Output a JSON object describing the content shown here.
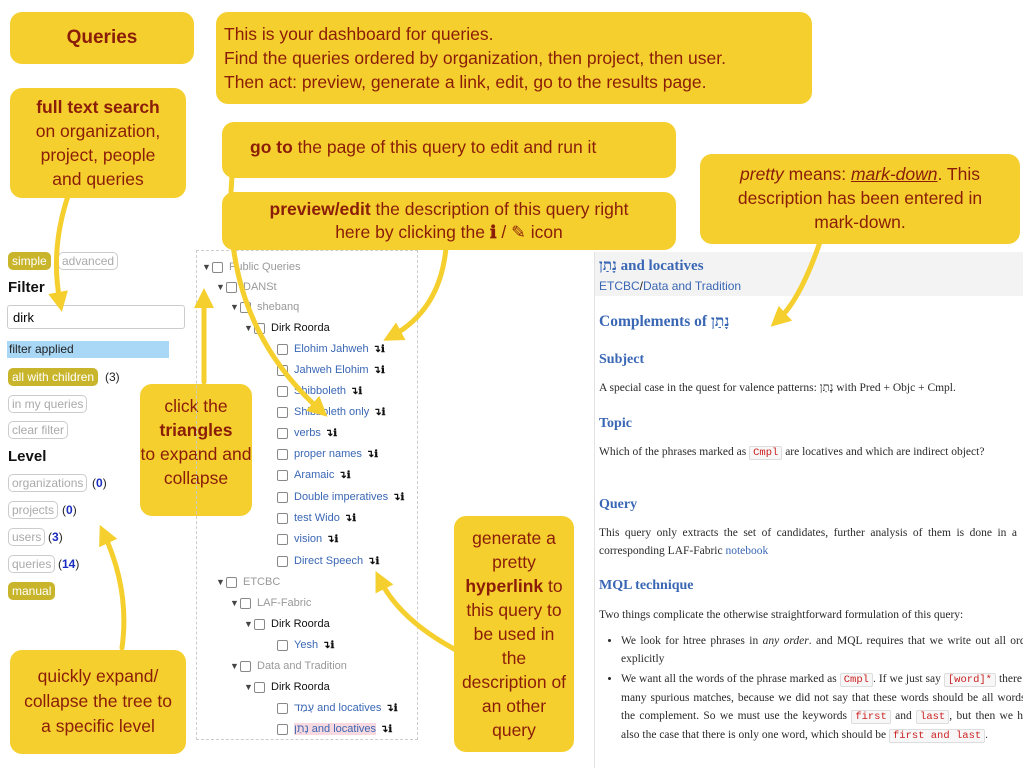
{
  "callouts": {
    "queries": "Queries",
    "dashboard_l1": "This is your dashboard for queries.",
    "dashboard_l2": "Find the queries ordered by organization, then project, then user.",
    "dashboard_l3": "Then act: preview, generate a link, edit, go to the results page.",
    "fts_bold": "full text search",
    "fts_rest_1": "on organization,",
    "fts_rest_2": "project, people",
    "fts_rest_3": "and queries",
    "goto_bold": "go to",
    "goto_rest": "the page of this query to edit and run it",
    "preview_bold": "preview/edit",
    "preview_rest_1": "the description of this query right",
    "preview_rest_2": "here by clicking the",
    "preview_rest_3": "icon",
    "pretty_it": "pretty",
    "pretty_mid": "means:",
    "pretty_md": "mark-down",
    "pretty_end": ". This description has been entered in mark-down.",
    "tri_1": "click the",
    "tri_bold": "triangles",
    "tri_2": "to expand and collapse",
    "gen_1": "generate a pretty",
    "gen_bold": "hyperlink",
    "gen_2": "to this query to be used in the description of an other query",
    "expand": "quickly expand/ collapse the tree to a specific level"
  },
  "filter": {
    "mode_simple": "simple",
    "mode_advanced": "advanced",
    "heading": "Filter",
    "search_value": "dirk",
    "status": "filter applied",
    "all_children": "all with children",
    "all_children_count": "(3)",
    "in_my_queries": "in my queries",
    "clear": "clear filter"
  },
  "level": {
    "heading": "Level",
    "items": [
      {
        "label": "organizations",
        "count": "0"
      },
      {
        "label": "projects",
        "count": "0"
      },
      {
        "label": "users",
        "count": "3"
      },
      {
        "label": "queries",
        "count": "14"
      }
    ],
    "manual": "manual"
  },
  "tree": {
    "root": "Public Queries",
    "org1": "DANSt",
    "proj1": "shebanq",
    "user1": "Dirk Roorda",
    "queries1": [
      "Elohim Jahweh",
      "Jahweh Elohim",
      "Shibboleth",
      "Shibboleth only",
      "verbs",
      "proper names",
      "Aramaic",
      "Double imperatives",
      "test Wido",
      "vision",
      "Direct Speech"
    ],
    "org2": "ETCBC",
    "proj2": "LAF-Fabric",
    "user2": "Dirk Roorda",
    "queries2": [
      "Yesh"
    ],
    "proj3": "Data and Tradition",
    "user3": "Dirk Roorda",
    "queries3": [
      "עָמַד and locatives",
      "נָתַן and locatives"
    ],
    "action_glyphs": "↴ℹ"
  },
  "description": {
    "title": "נָתַן and locatives",
    "crumb_org": "ETCBC",
    "crumb_sep": "/",
    "crumb_proj": "Data and Tradition",
    "h1": "Complements of נָתַן",
    "subject_h": "Subject",
    "subject_p": "A special case in the quest for valence patterns: נָתַן with Pred + Objc + Cmpl.",
    "topic_h": "Topic",
    "topic_p1": "Which of the phrases marked as",
    "topic_code": "Cmpl",
    "topic_p2": "are locatives and which are indirect object?",
    "query_h": "Query",
    "query_p": "This query only extracts the set of candidates, further analysis of them is done in a corresponding LAF-Fabric",
    "query_link": "notebook",
    "mql_h": "MQL technique",
    "mql_p": "Two things complicate the otherwise straightforward formulation of this query:",
    "b1_a": "We look for htree phrases in",
    "b1_em": "any order",
    "b1_b": ". and MQL requires that we write out all orders explicitly",
    "b2_a": "We want all the words of the phrase marked as",
    "b2_code1": "Cmpl",
    "b2_b": ". If we just say",
    "b2_code2": "[word]*",
    "b2_c": "there are many spurious matches, because we did not say that these words should be all words of the complement. So we must use the keywords",
    "b2_code3": "first",
    "b2_and": "and",
    "b2_code4": "last",
    "b2_d": ", but then we have also the case that there is only one word, which should be",
    "b2_code5": "first and last",
    "b2_e": "."
  },
  "colors": {
    "callout_bg": "#f5cf2e",
    "callout_text": "#8a1d08",
    "link": "#3a67b4",
    "pill_on": "#c9b52c"
  }
}
